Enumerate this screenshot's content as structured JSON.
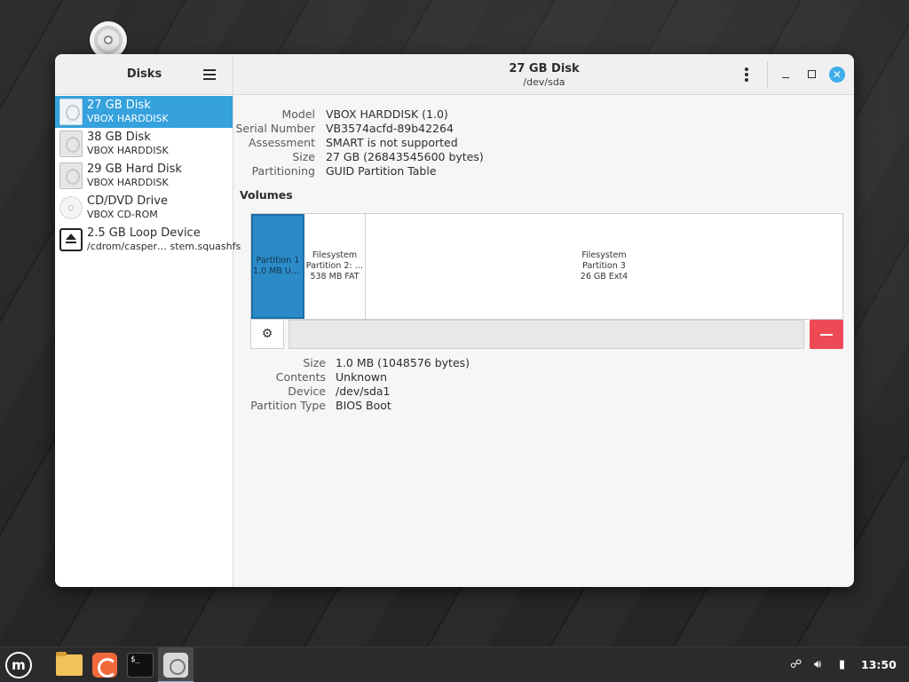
{
  "window": {
    "sidebar_title": "Disks",
    "title": "27 GB Disk",
    "subtitle": "/dev/sda"
  },
  "sidebar": {
    "items": [
      {
        "name": "27 GB Disk",
        "sub": "VBOX HARDDISK",
        "icon": "hard-disk-icon",
        "selected": true
      },
      {
        "name": "38 GB Disk",
        "sub": "VBOX HARDDISK",
        "icon": "hard-disk-icon",
        "selected": false
      },
      {
        "name": "29 GB Hard Disk",
        "sub": "VBOX HARDDISK",
        "icon": "hard-disk-icon",
        "selected": false
      },
      {
        "name": "CD/DVD Drive",
        "sub": "VBOX CD-ROM",
        "icon": "optical-disc-icon",
        "selected": false
      },
      {
        "name": "2.5 GB Loop Device",
        "sub": "/cdrom/casper… stem.squashfs",
        "icon": "eject-icon",
        "selected": false
      }
    ]
  },
  "disk_info": [
    {
      "label": "Model",
      "value": "VBOX HARDDISK (1.0)"
    },
    {
      "label": "Serial Number",
      "value": "VB3574acfd-89b42264"
    },
    {
      "label": "Assessment",
      "value": "SMART is not supported"
    },
    {
      "label": "Size",
      "value": "27 GB (26843545600 bytes)"
    },
    {
      "label": "Partitioning",
      "value": "GUID Partition Table"
    }
  ],
  "volumes": {
    "title": "Volumes",
    "segments": [
      {
        "lines": [
          "Partition 1",
          "1.0 MB Un…"
        ],
        "selected": true
      },
      {
        "lines": [
          "Filesystem",
          "Partition 2: …",
          "538 MB FAT"
        ],
        "selected": false
      },
      {
        "lines": [
          "Filesystem",
          "Partition 3",
          "26 GB Ext4"
        ],
        "selected": false
      }
    ]
  },
  "partition_info": [
    {
      "label": "Size",
      "value": "1.0 MB (1048576 bytes)"
    },
    {
      "label": "Contents",
      "value": "Unknown"
    },
    {
      "label": "Device",
      "value": "/dev/sda1"
    },
    {
      "label": "Partition Type",
      "value": "BIOS Boot"
    }
  ],
  "taskbar": {
    "terminal_glyph": "$_",
    "clock": "13:50",
    "tray": [
      "network-icon",
      "volume-icon",
      "battery-icon"
    ]
  },
  "colors": {
    "accent": "#35a1dd",
    "delete": "#ee4a55"
  }
}
